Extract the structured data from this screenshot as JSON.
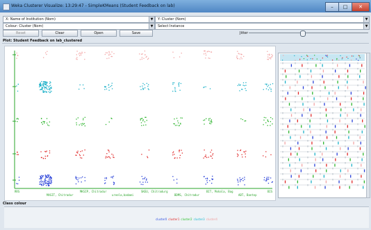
{
  "window": {
    "title": "Weka Clusterer Visualize: 13:29:47 - SimpleKMeans (Student Feedback on lab)",
    "icon": "weka-bird-icon",
    "controls": [
      "–",
      "□",
      "✕"
    ]
  },
  "axes_controls": {
    "x_select": "X: Name of Institution (Nom)",
    "y_select": "Y: Cluster (Nom)",
    "colour_select": "Colour: Cluster (Nom)",
    "instance_select": "Select Instance"
  },
  "buttons": {
    "reset": "Reset",
    "clear": "Clear",
    "open": "Open",
    "save": "Save"
  },
  "jitter": {
    "label": "Jitter",
    "value_fraction": 0.45
  },
  "plot": {
    "title": "Plot: Student Feedback on lab_clustered",
    "x_tick_labels": [
      "RRS",
      "MASIT, Chitradur",
      "MKSIP, Chitradur",
      "ureela,badami",
      "SKEU, Chitradurg",
      "BDMS, Chitradur",
      "BIT, Mohala, Bag",
      "ABT, Bantep",
      "BIS"
    ]
  },
  "colour_legend": {
    "label": "Class colour",
    "entries": [
      {
        "name": "cluster0",
        "color": "#3050e0"
      },
      {
        "name": "cluster1",
        "color": "#e03030"
      },
      {
        "name": "cluster2",
        "color": "#30c030"
      },
      {
        "name": "cluster3",
        "color": "#20b8d0"
      },
      {
        "name": "cluster4",
        "color": "#f0a0a0"
      }
    ]
  },
  "colors": {
    "cluster0": "#2840d8",
    "cluster1": "#e02828",
    "cluster2": "#2cb42c",
    "cluster3": "#1ab0c8",
    "cluster4": "#f2a4a4",
    "axis": "#2aa42a"
  }
}
